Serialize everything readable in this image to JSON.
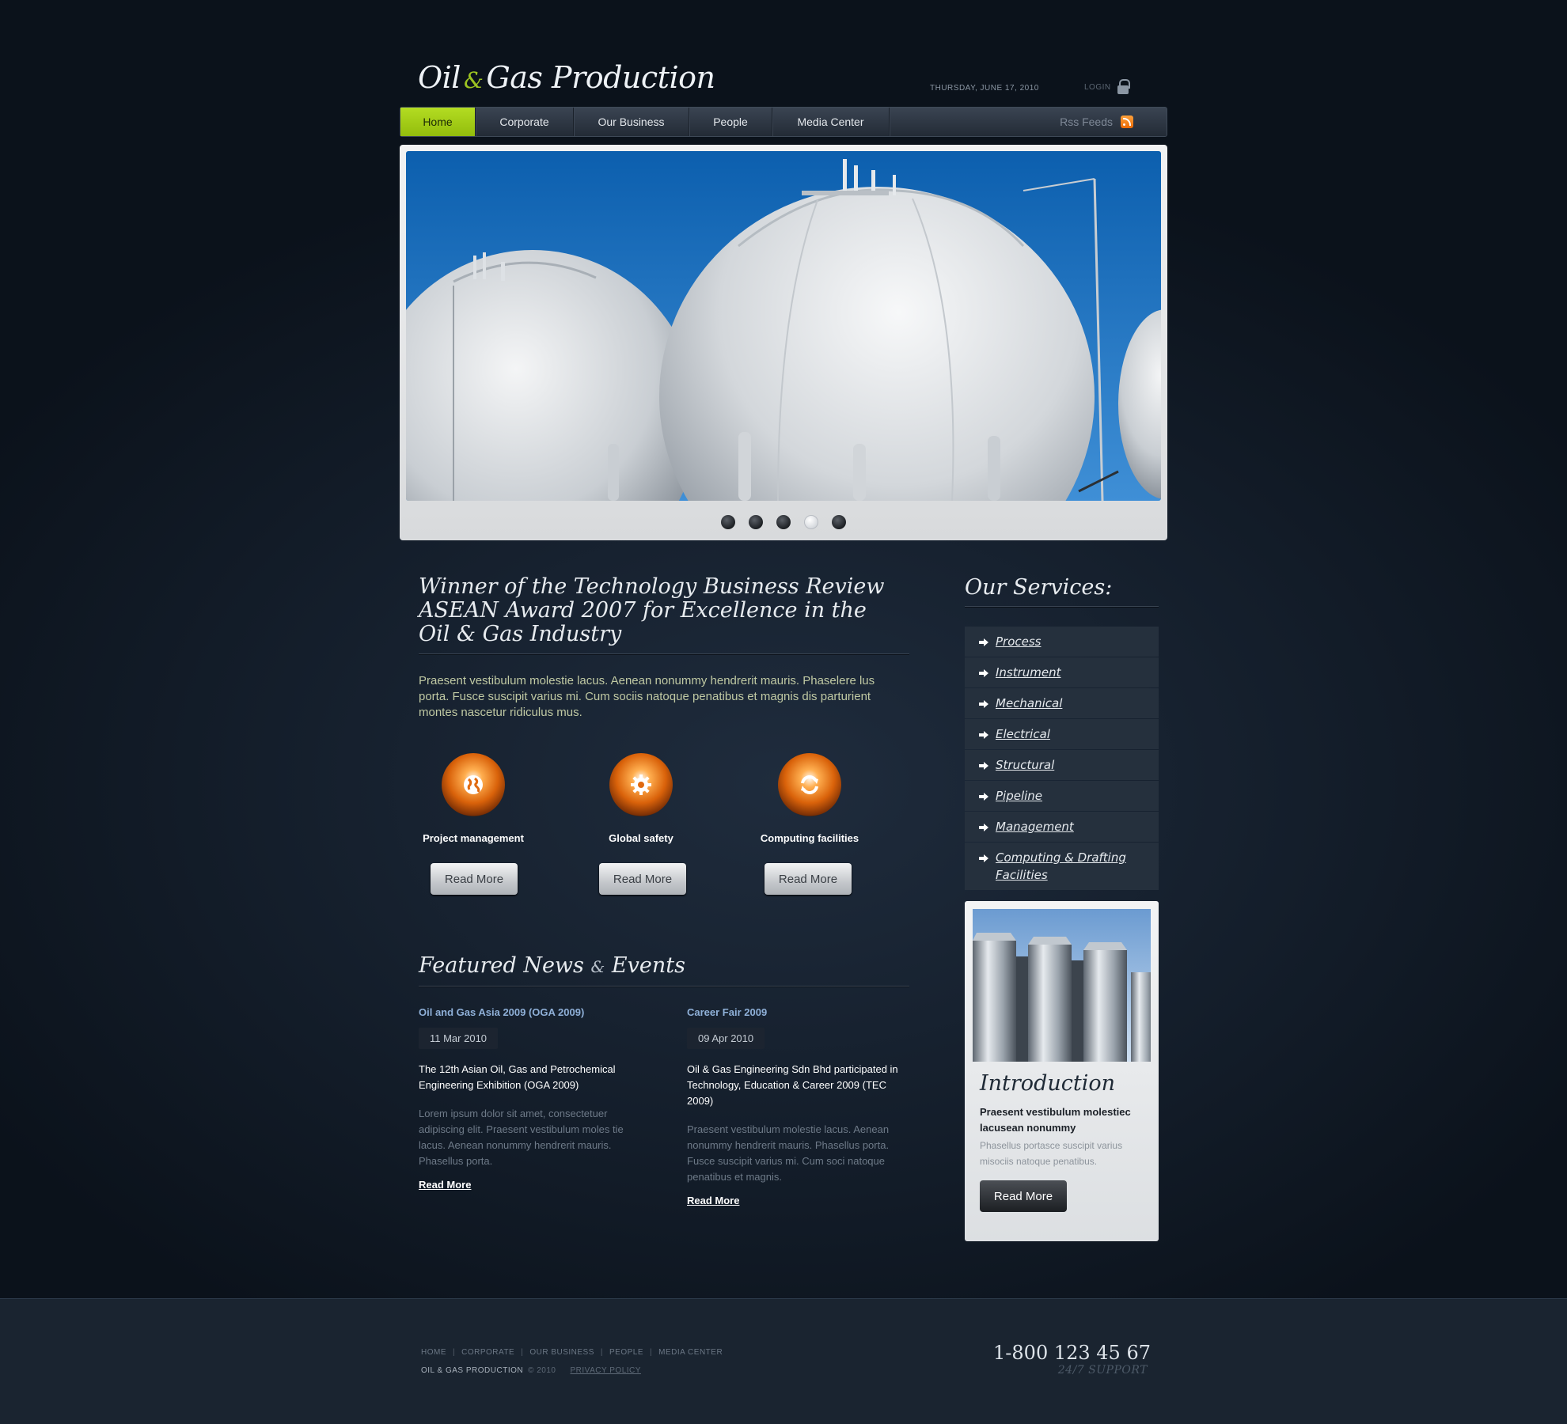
{
  "header": {
    "logo_oil": "Oil",
    "logo_amp": "&",
    "logo_rest": "Gas Production",
    "date": "THURSDAY, JUNE 17, 2010",
    "login": "LOGIN"
  },
  "nav": {
    "items": [
      "Home",
      "Corporate",
      "Our Business",
      "People",
      "Media Center"
    ],
    "active": "Home",
    "rss": "Rss Feeds"
  },
  "slider": {
    "dots": 5,
    "active_dot": 4
  },
  "main": {
    "headline": "Winner of the Technology Business Review ASEAN Award 2007 for Excellence in the Oil & Gas Industry",
    "intro": "Praesent vestibulum molestie lacus. Aenean nonummy hendrerit mauris. Phaselere lus porta. Fusce suscipit varius mi. Cum sociis natoque penatibus et magnis dis parturient montes nascetur ridiculus mus.",
    "features": [
      {
        "title": "Project management",
        "icon": "globe-icon",
        "button": "Read More"
      },
      {
        "title": "Global safety",
        "icon": "gear-icon",
        "button": "Read More"
      },
      {
        "title": "Computing facilities",
        "icon": "refresh-icon",
        "button": "Read More"
      }
    ]
  },
  "news": {
    "title_a": "Featured News",
    "title_amp": "&",
    "title_b": "Events",
    "items": [
      {
        "title": "Oil and Gas Asia 2009 (OGA 2009)",
        "date": "11 Mar 2010",
        "lead": "The 12th Asian Oil, Gas and Petrochemical Engineering Exhibition (OGA 2009)",
        "body": "Lorem ipsum dolor sit amet, consectetuer adipiscing elit. Praesent vestibulum moles tie lacus. Aenean nonummy hendrerit mauris. Phasellus porta.",
        "more": "Read More"
      },
      {
        "title": "Career Fair 2009",
        "date": "09 Apr 2010",
        "lead": "Oil & Gas Engineering Sdn Bhd participated in Technology, Education & Career 2009 (TEC 2009)",
        "body": "Praesent vestibulum molestie lacus. Aenean nonummy hendrerit mauris. Phasellus porta. Fusce suscipit varius mi. Cum soci natoque penatibus et magnis.",
        "more": "Read More"
      }
    ]
  },
  "sidebar": {
    "services_title": "Our Services:",
    "services": [
      "Process",
      "Instrument",
      "Mechanical",
      "Electrical",
      "Structural",
      "Pipeline",
      "Management",
      "Computing & Drafting Facilities"
    ],
    "intro_title": "Introduction",
    "intro_bold": "Praesent vestibulum molestiec lacusean nonummy",
    "intro_text": "Phasellus portasce suscipit varius misociis natoque penatibus.",
    "intro_button": "Read More"
  },
  "footer": {
    "links": [
      "HOME",
      "CORPORATE",
      "OUR BUSINESS",
      "PEOPLE",
      "MEDIA CENTER"
    ],
    "brand": "OIL & GAS PRODUCTION",
    "copyright": "© 2010",
    "privacy": "PRIVACY POLICY",
    "phone": "1-800 123 45 67",
    "support": "24/7 SUPPORT"
  },
  "colors": {
    "accent": "#9cc321",
    "background": "#141e2b",
    "icon_orange": "#e27011"
  }
}
